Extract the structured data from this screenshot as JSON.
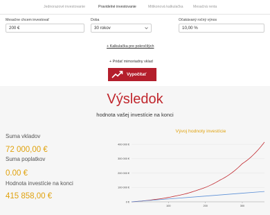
{
  "tabs": [
    {
      "label": "Jednorazové investovanie",
      "active": false
    },
    {
      "label": "Pravidelné investovanie",
      "active": true
    },
    {
      "label": "Mitikonová kalkulačka",
      "active": false
    },
    {
      "label": "Mesačná renta",
      "active": false
    }
  ],
  "form": {
    "monthly": {
      "label": "Mesačne chcem investovať",
      "value": "200 €"
    },
    "period": {
      "label": "Doba",
      "value": "30 rokov"
    },
    "yield": {
      "label": "Očakávaný ročný výnos",
      "value": "10,00 %"
    }
  },
  "advanced_link": "+ Kalkulačka pre pokročilých",
  "extra_deposit": "+ Pridať mimoriadny vklad",
  "calc_button": "Vypočítať",
  "result": {
    "title": "Výsledok",
    "subtitle": "hodnota vašej investície na konci",
    "deposits_label": "Suma vkladov",
    "deposits_value": "72 000,00 €",
    "fees_label": "Suma poplatkov",
    "fees_value": "0.00 €",
    "end_label": "Hodnota investície na konci",
    "end_value": "415 858,00 €"
  },
  "colors": {
    "accent": "#b41e2b",
    "gold": "#e0a20d",
    "value_line": "#c0272d",
    "deposit_line": "#5b8fd6"
  },
  "chart_data": {
    "type": "line",
    "title": "Vývoj hodnoty investície",
    "xlabel": "",
    "ylabel": "",
    "x_ticks": [
      100,
      200,
      300
    ],
    "y_ticks": [
      "0 €",
      "100 000 €",
      "200 000 €",
      "300 000 €",
      "400 000 €"
    ],
    "y_tick_values": [
      0,
      100000,
      200000,
      300000,
      400000
    ],
    "xlim": [
      0,
      360
    ],
    "ylim": [
      0,
      420000
    ],
    "grid": "horizontal",
    "series": [
      {
        "x": [
          0,
          60,
          120,
          180,
          240,
          300,
          360
        ],
        "values": [
          0,
          15500,
          41000,
          82900,
          151900,
          265600,
          415858
        ]
      },
      {
        "x": [
          0,
          60,
          120,
          180,
          240,
          300,
          360
        ],
        "values": [
          0,
          12000,
          24000,
          36000,
          48000,
          60000,
          72000
        ]
      }
    ]
  }
}
